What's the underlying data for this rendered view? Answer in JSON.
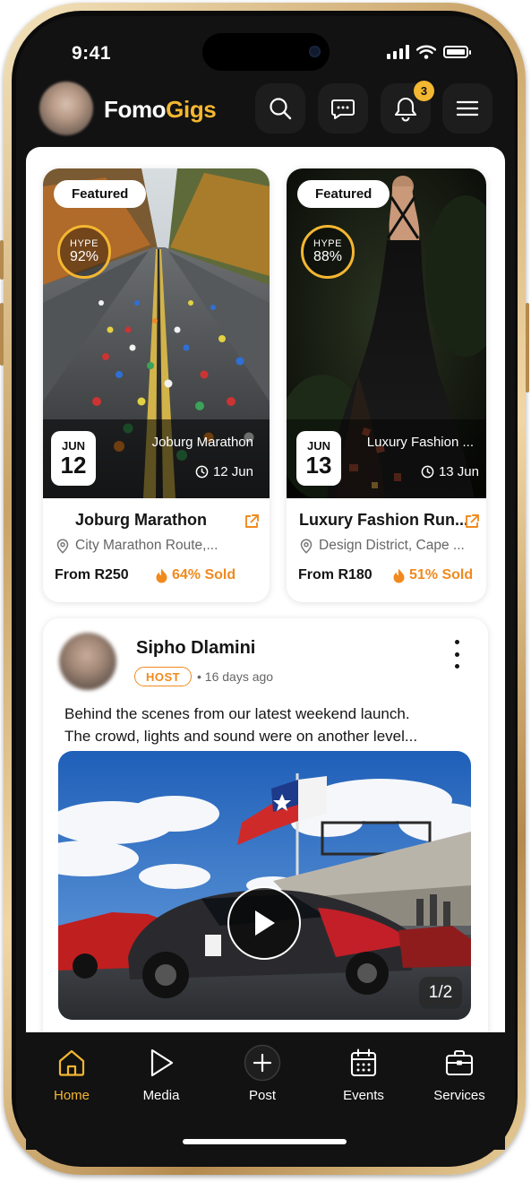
{
  "status_bar": {
    "time": "9:41"
  },
  "header": {
    "logo_part1": "Fomo",
    "logo_part2": "Gigs",
    "notification_count": "3",
    "icons": [
      "search-icon",
      "chat-icon",
      "bell-icon",
      "menu-icon"
    ]
  },
  "events": [
    {
      "badge": "Featured",
      "hype_label": "HYPE",
      "hype_value": "92%",
      "month": "JUN",
      "day": "12",
      "image_title": "Joburg Marathon",
      "image_date": "12 Jun",
      "title": "Joburg Marathon",
      "location": "City Marathon Route,...",
      "price": "From R250",
      "sold": "64% Sold"
    },
    {
      "badge": "Featured",
      "hype_label": "HYPE",
      "hype_value": "88%",
      "month": "JUN",
      "day": "13",
      "image_title": "Luxury Fashion ...",
      "image_date": "13 Jun",
      "title": "Luxury Fashion Run...",
      "location": "Design District, Cape ...",
      "price": "From R180",
      "sold": "51% Sold"
    }
  ],
  "post": {
    "author": "Sipho Dlamini",
    "role": "HOST",
    "time": "16 days ago",
    "text_line1": "Behind the scenes from our latest weekend launch.",
    "text_line2": "The crowd, lights and sound were on another level...",
    "media_counter": "1/2"
  },
  "nav": {
    "items": [
      {
        "label": "Home",
        "icon": "home-icon",
        "active": true
      },
      {
        "label": "Media",
        "icon": "play-icon",
        "active": false
      },
      {
        "label": "Post",
        "icon": "plus-circle-icon",
        "active": false
      },
      {
        "label": "Events",
        "icon": "calendar-icon",
        "active": false
      },
      {
        "label": "Services",
        "icon": "briefcase-icon",
        "active": false
      }
    ]
  },
  "colors": {
    "accent": "#f4b731",
    "sold": "#f08a1f",
    "background": "#121212"
  }
}
